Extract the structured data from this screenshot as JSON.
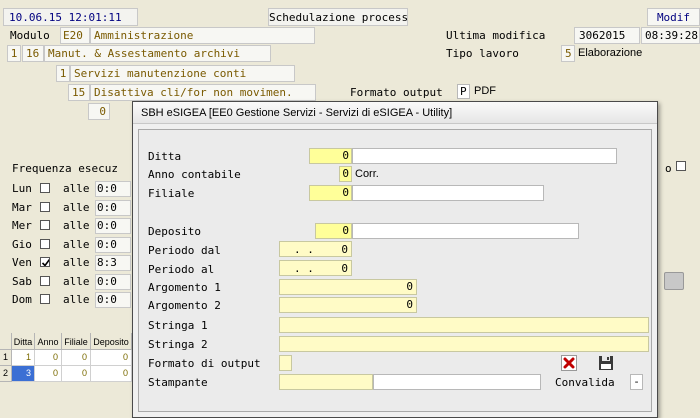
{
  "header": {
    "datetime": "10.06.15 12:01:11",
    "title": "Schedulazione processi",
    "mode": "Modif"
  },
  "modulo": {
    "label": "Modulo",
    "code": "E20",
    "name": "Amministrazione"
  },
  "ultima_modifica": {
    "label": "Ultima modifica",
    "date": "3062015",
    "time": "08:39:28"
  },
  "tipo_lavoro": {
    "label": "Tipo lavoro",
    "code": "5",
    "name": "Elaborazione"
  },
  "tree": [
    {
      "a": "1",
      "b": "16",
      "text": "Manut. & Assestamento archivi"
    },
    {
      "a": "1",
      "text": "Servizi manutenzione conti"
    },
    {
      "a": "15",
      "text": "Disattiva cli/for non movimen."
    }
  ],
  "formato_output": {
    "label": "Formato output",
    "code": "P",
    "name": "PDF"
  },
  "row4_value": "0",
  "frequenza": {
    "label": "Frequenza esecuz",
    "alle": "alle",
    "days": [
      {
        "name": "Lun",
        "checked": false,
        "time": "0:0"
      },
      {
        "name": "Mar",
        "checked": false,
        "time": "0:0"
      },
      {
        "name": "Mer",
        "checked": false,
        "time": "0:0"
      },
      {
        "name": "Gio",
        "checked": false,
        "time": "0:0"
      },
      {
        "name": "Ven",
        "checked": true,
        "time": "8:3"
      },
      {
        "name": "Sab",
        "checked": false,
        "time": "0:0"
      },
      {
        "name": "Dom",
        "checked": false,
        "time": "0:0"
      }
    ],
    "right_fragment": "o"
  },
  "grid": {
    "columns": [
      "Ditta",
      "Anno",
      "Filiale",
      "Deposito"
    ],
    "rows": [
      {
        "n": "1",
        "cells": [
          "1",
          "0",
          "0",
          "0"
        ]
      },
      {
        "n": "2",
        "cells": [
          "3",
          "0",
          "0",
          "0"
        ]
      }
    ]
  },
  "dialog": {
    "title": "SBH eSIGEA [EE0 Gestione Servizi - Servizi di eSIGEA - Utility]",
    "ditta": {
      "label": "Ditta",
      "value": "0"
    },
    "anno": {
      "label": "Anno contabile",
      "value": "0",
      "suffix": "Corr."
    },
    "filiale": {
      "label": "Filiale",
      "value": "0"
    },
    "deposito": {
      "label": "Deposito",
      "value": "0"
    },
    "periodo_dal": {
      "label": "Periodo dal",
      "date": ". .",
      "value": "0"
    },
    "periodo_al": {
      "label": "Periodo  al",
      "date": ". .",
      "value": "0"
    },
    "argomento1": {
      "label": "Argomento 1",
      "value": "0"
    },
    "argomento2": {
      "label": "Argomento 2",
      "value": "0"
    },
    "stringa1": {
      "label": "Stringa   1",
      "value": ""
    },
    "stringa2": {
      "label": "Stringa   2",
      "value": ""
    },
    "formato": {
      "label": "Formato di output",
      "value": ""
    },
    "stampante": {
      "label": "Stampante",
      "value": ""
    },
    "convalida": {
      "label": "Convalida",
      "value": "-"
    }
  }
}
